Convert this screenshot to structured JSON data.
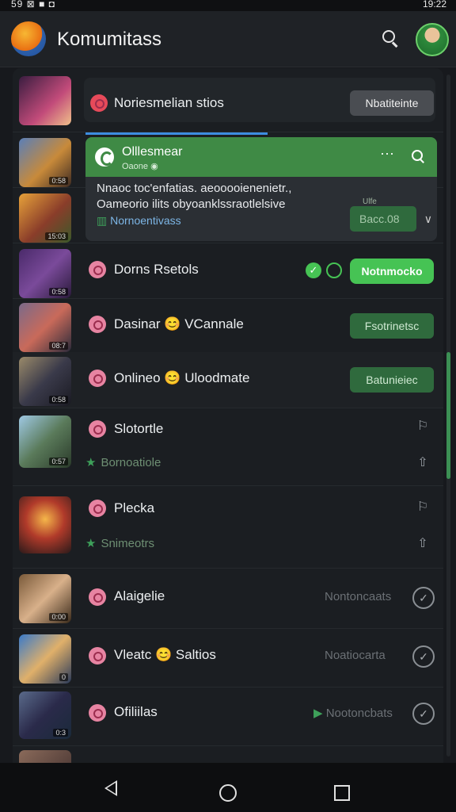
{
  "status_bar": {
    "left": "59 ⊠ ■ ◘",
    "time": "19:22"
  },
  "app": {
    "title": "Komumitass"
  },
  "rows": [
    {
      "name": "Noriesmelian stios",
      "action": "Nbatiteinte",
      "thumb_tag": ""
    },
    {
      "name": "",
      "action": "",
      "thumb_tag": "0:58"
    },
    {
      "name": "",
      "action": "",
      "thumb_tag": "15:03"
    },
    {
      "name": "Dorns Rsetols",
      "action": "Notnmocko",
      "thumb_tag": "0:58"
    },
    {
      "name": "Dasinar 😊 VCannale",
      "action": "Fsotrinetsc",
      "thumb_tag": "08:7"
    },
    {
      "name": "Onlineo 😊 Uloodmate",
      "action": "Batunieiec",
      "thumb_tag": "0:58"
    },
    {
      "name": "Slotortle",
      "sub": "Bornoatiole",
      "thumb_tag": "0:57"
    },
    {
      "name": "Plecka",
      "sub": "Snimeotrs",
      "thumb_tag": ""
    },
    {
      "name": "Alaigelie",
      "status": "Nontoncaats",
      "thumb_tag": "0:00"
    },
    {
      "name": "Vleatc 😊 Saltios",
      "status": "Noatiocarta",
      "thumb_tag": "0"
    },
    {
      "name": "Ofiliilas",
      "status": "Nootoncbats",
      "thumb_tag": "0:3"
    }
  ],
  "popup": {
    "title": "Olllesmear",
    "subtitle": "Oaone ◉",
    "body_line1": "Nnaoc toc'enfatias. aeooooienenietr.,",
    "body_line2": "Oameorio ilits obyoanklssraotlelsive",
    "link": "Nornoentivass",
    "faint": "Ulfe",
    "button": "Bacc.08",
    "more": "···"
  },
  "icons": {
    "search": "search-icon",
    "more": "more-icon",
    "check": "check-circle-icon",
    "bookmark": "bookmark-icon",
    "share": "share-icon"
  },
  "colors": {
    "accent": "#46c354",
    "header": "#3f8a45",
    "background": "#17191d"
  }
}
